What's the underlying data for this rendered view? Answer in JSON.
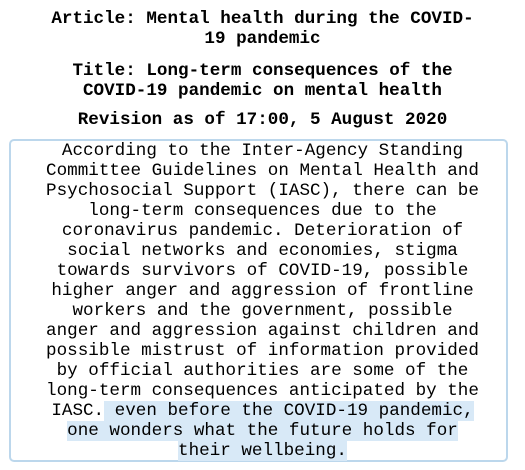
{
  "header": {
    "article_line1": "Article: Mental health during the COVID-",
    "article_line2": "19 pandemic",
    "title_line1": "Title: Long-term consequences of the",
    "title_line2": "COVID-19 pandemic on mental health",
    "revision": "Revision as of 17:00, 5 August 2020"
  },
  "body": {
    "lines": [
      "According to the Inter-Agency Standing",
      "Committee Guidelines on Mental Health and",
      "Psychosocial Support (IASC), there can be",
      "long-term consequences due to the",
      "coronavirus pandemic. Deterioration of",
      "social networks and economies, stigma",
      "towards survivors of COVID-19, possible",
      "higher anger and aggression of frontline",
      "workers and the government, possible",
      "anger and aggression against children and",
      "possible mistrust of information provided",
      "by official authorities are some of the",
      "long-term consequences anticipated by the"
    ],
    "last_lines": {
      "line14_plain": "IASC.",
      "line14_highlight": " even before the COVID-19 pandemic,",
      "line15_highlight": "one wonders what the future holds for",
      "line16_highlight": "their wellbeing."
    }
  },
  "colors": {
    "box_border": "#bcd7ec",
    "highlight": "#d8e9f7",
    "text": "#000000"
  }
}
